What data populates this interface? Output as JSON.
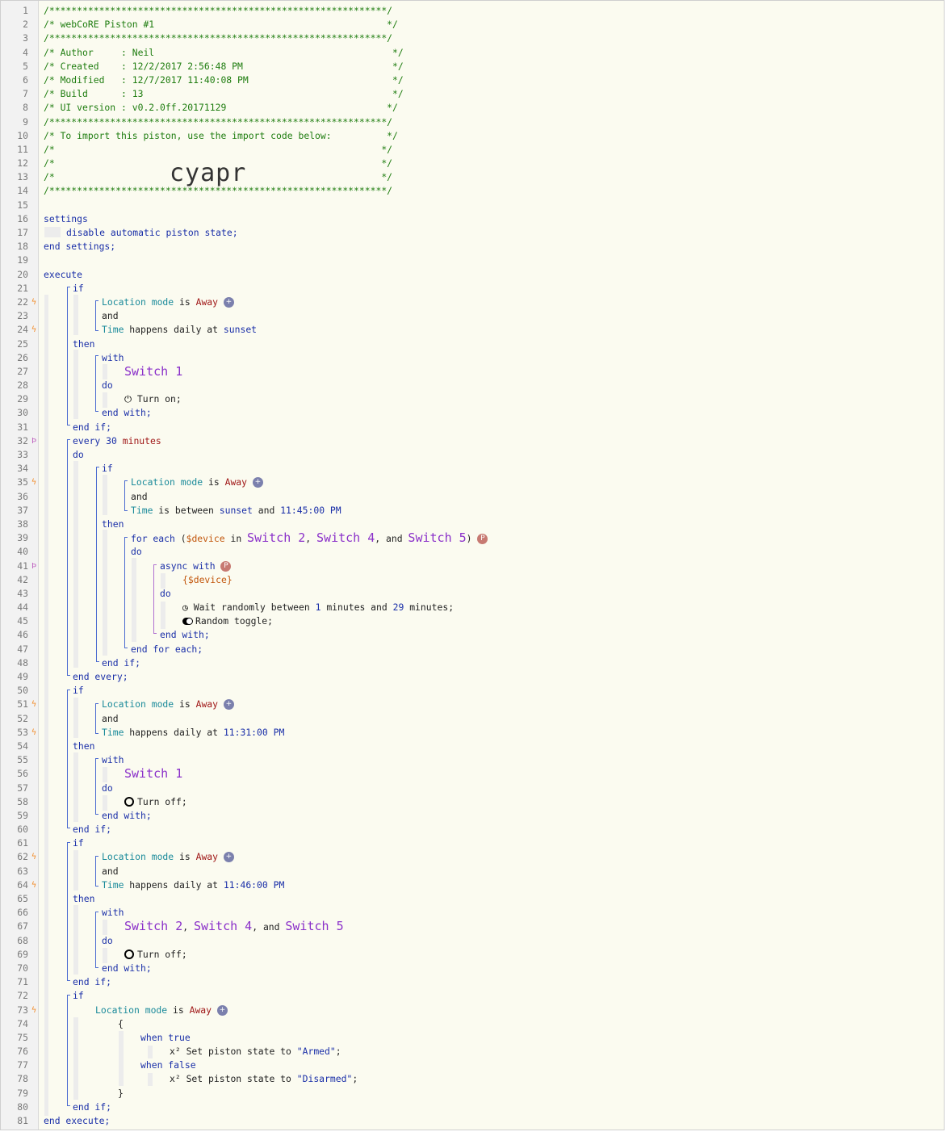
{
  "header": {
    "border": "/*************************************************************/",
    "title": "/* webCoRE Piston #1                                          */",
    "author": "/* Author     : Neil                                           */",
    "created": "/* Created    : 12/2/2017 2:56:48 PM                           */",
    "modified": "/* Modified   : 12/7/2017 11:40:08 PM                          */",
    "build": "/* Build      : 13                                             */",
    "ui_version": "/* UI version : v0.2.0ff.20171129                             */",
    "import_note": "/* To import this piston, use the import code below:          */",
    "blank": "/*                                                           */",
    "import_code": "cyapr"
  },
  "settings": {
    "open": "settings",
    "line": "disable automatic piston state;",
    "close": "end settings;"
  },
  "kw": {
    "execute": "execute",
    "end_execute": "end execute;",
    "if": "if",
    "and": "and",
    "then": "then",
    "with": "with",
    "do": "do",
    "end_with": "end with;",
    "end_if": "end if;",
    "every": "every",
    "minutes": "minutes",
    "end_every": "end every;",
    "for_each": "for each",
    "in": "in",
    "end_for_each": "end for each;",
    "async_with": "async with",
    "when_true": "when true",
    "when_false": "when false",
    "open_brace": "{",
    "close_brace": "}",
    "is": "is",
    "is_between": "is between",
    "happens_daily_at": "happens daily at",
    "comma": ",",
    "and_word": "and"
  },
  "terms": {
    "location_mode": "Location mode",
    "away": "Away",
    "time": "Time",
    "sunset": "sunset",
    "t_1145": "11:45:00 PM",
    "t_1131": "11:31:00 PM",
    "t_1146": "11:46:00 PM",
    "every_n": "30",
    "device_var": "$device",
    "device_var_braced": "{$device}"
  },
  "devices": {
    "switch1": "Switch 1",
    "switch2": "Switch 2",
    "switch4": "Switch 4",
    "switch5": "Switch 5"
  },
  "actions": {
    "turn_on": "Turn on;",
    "turn_off": "Turn off;",
    "wait_a": "Wait randomly between",
    "wait_min": "1",
    "wait_mid": "minutes and",
    "wait_max": "29",
    "wait_end": "minutes;",
    "random_toggle": "Random toggle;",
    "set_state": "Set piston state to",
    "armed": "\"Armed\"",
    "disarmed": "\"Disarmed\"",
    "x2": "x²"
  },
  "badges": {
    "plus": "+",
    "p": "P"
  },
  "gutter_marks": {
    "bolt": "ϟ",
    "p": "Þ"
  },
  "line_numbers": [
    "1",
    "2",
    "3",
    "4",
    "5",
    "6",
    "7",
    "8",
    "9",
    "10",
    "11",
    "12",
    "13",
    "14",
    "15",
    "16",
    "17",
    "18",
    "19",
    "20",
    "21",
    "22",
    "23",
    "24",
    "25",
    "26",
    "27",
    "28",
    "29",
    "30",
    "31",
    "32",
    "33",
    "34",
    "35",
    "36",
    "37",
    "38",
    "39",
    "40",
    "41",
    "42",
    "43",
    "44",
    "45",
    "46",
    "47",
    "48",
    "49",
    "50",
    "51",
    "52",
    "53",
    "54",
    "55",
    "56",
    "57",
    "58",
    "59",
    "60",
    "61",
    "62",
    "63",
    "64",
    "65",
    "66",
    "67",
    "68",
    "69",
    "70",
    "71",
    "72",
    "73",
    "74",
    "75",
    "76",
    "77",
    "78",
    "79",
    "80",
    "81"
  ],
  "colors": {
    "comment": "#1f7d10",
    "keyword": "#1a2fa8",
    "device": "#8a2fc9",
    "value": "#a01818",
    "bolt": "#f28c28"
  }
}
